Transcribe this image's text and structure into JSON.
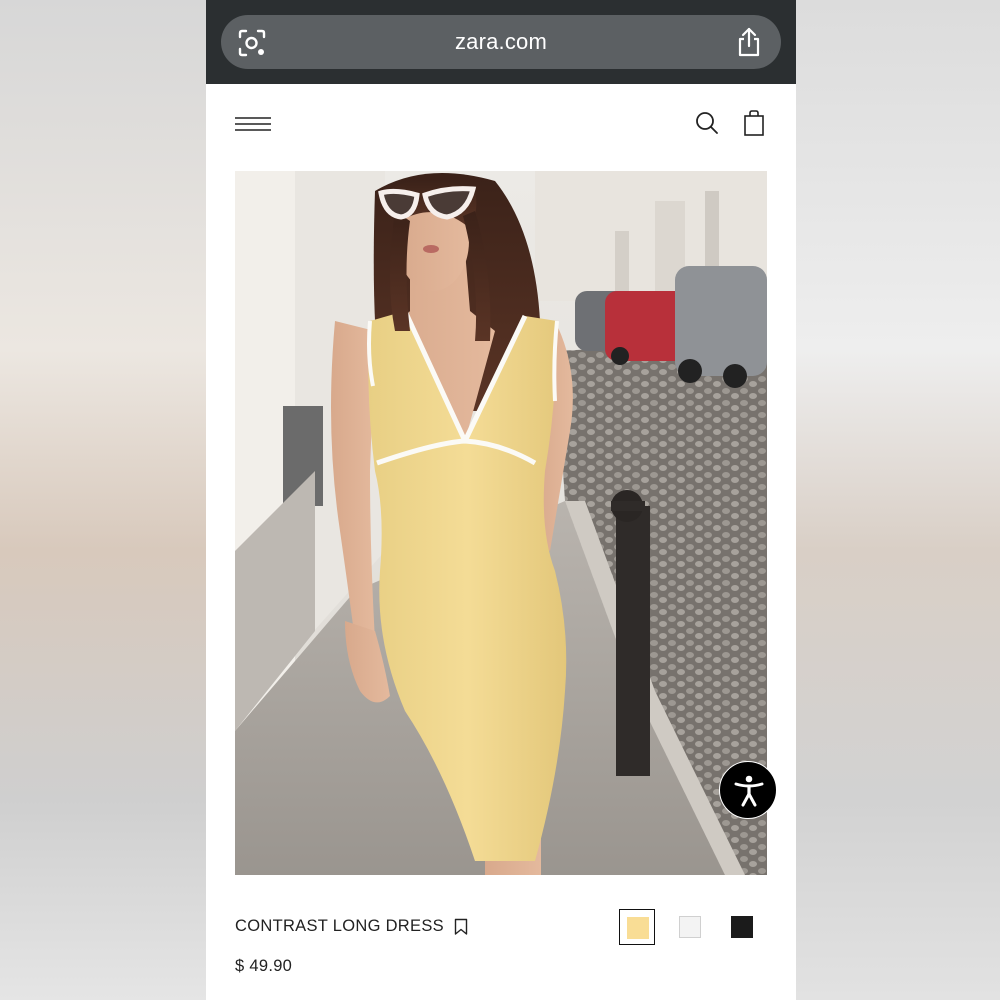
{
  "browser": {
    "url": "zara.com",
    "icons": [
      "visual-search-icon",
      "share-icon"
    ]
  },
  "header": {
    "icons": [
      "menu-icon",
      "search-icon",
      "shopping-bag-icon"
    ]
  },
  "product": {
    "name": "CONTRAST LONG DRESS",
    "price": "$ 49.90",
    "image_alt": "Model walking on a cobblestone street wearing a yellow long dress with white contrast trim",
    "colors": [
      {
        "name": "yellow",
        "hex": "#f9dd95",
        "selected": true
      },
      {
        "name": "white",
        "hex": "#f3f3f3",
        "selected": false
      },
      {
        "name": "black",
        "hex": "#1b1b1b",
        "selected": false
      }
    ]
  },
  "accessibility": {
    "icon": "accessibility-icon"
  },
  "theme": {
    "browser_bar": "#2b2f31",
    "url_pill": "#5c6063",
    "text": "#222222"
  }
}
